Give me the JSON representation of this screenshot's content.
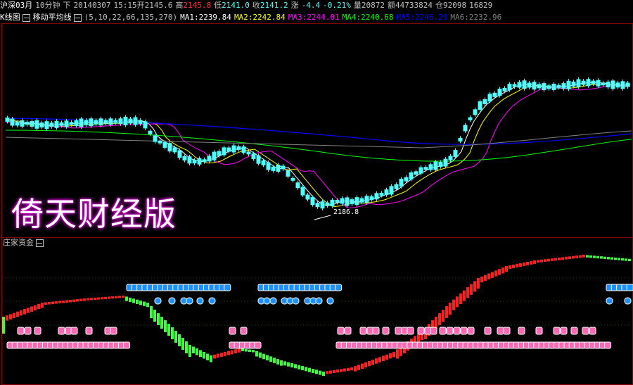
{
  "header": {
    "market": "沪深03月",
    "period": "10分钟",
    "side": "下",
    "date": "20140307",
    "time": "15:15",
    "open_label": "开",
    "open": "2145.6",
    "high_label": "高",
    "high": "2145.8",
    "low_label": "低",
    "low": "2141.0",
    "close_label": "收",
    "close": "2141.2",
    "change_label": "涨",
    "change": "-4.4",
    "change_pct": "-0.21%",
    "volume_label": "量",
    "volume": "20872",
    "amount_label": "额",
    "amount": "44733824",
    "position_label": "仓",
    "position": "92098",
    "extra": "16829"
  },
  "ma_bar": {
    "kline_label": "K线图",
    "ma_label": "移动平均线",
    "params": "(5,10,22,66,135,270)",
    "ma": [
      {
        "name": "MA1:",
        "value": "2239.84",
        "color": "#ffffff"
      },
      {
        "name": "MA2:",
        "value": "2242.84",
        "color": "#ffff00"
      },
      {
        "name": "MA3:",
        "value": "2244.01",
        "color": "#ff00ff"
      },
      {
        "name": "MA4:",
        "value": "2240.68",
        "color": "#00ff00"
      },
      {
        "name": "MA5:",
        "value": "2246.20",
        "color": "#0000ff"
      },
      {
        "name": "MA6:",
        "value": "2232.96",
        "color": "#808080"
      }
    ]
  },
  "main_chart": {
    "low_marker": "2186.8",
    "watermark": "倚天财经版"
  },
  "sub_chart": {
    "title": "庄家资金"
  },
  "colors": {
    "up": "#ff3232",
    "down": "#54ffff",
    "frame": "#8b0000"
  }
}
